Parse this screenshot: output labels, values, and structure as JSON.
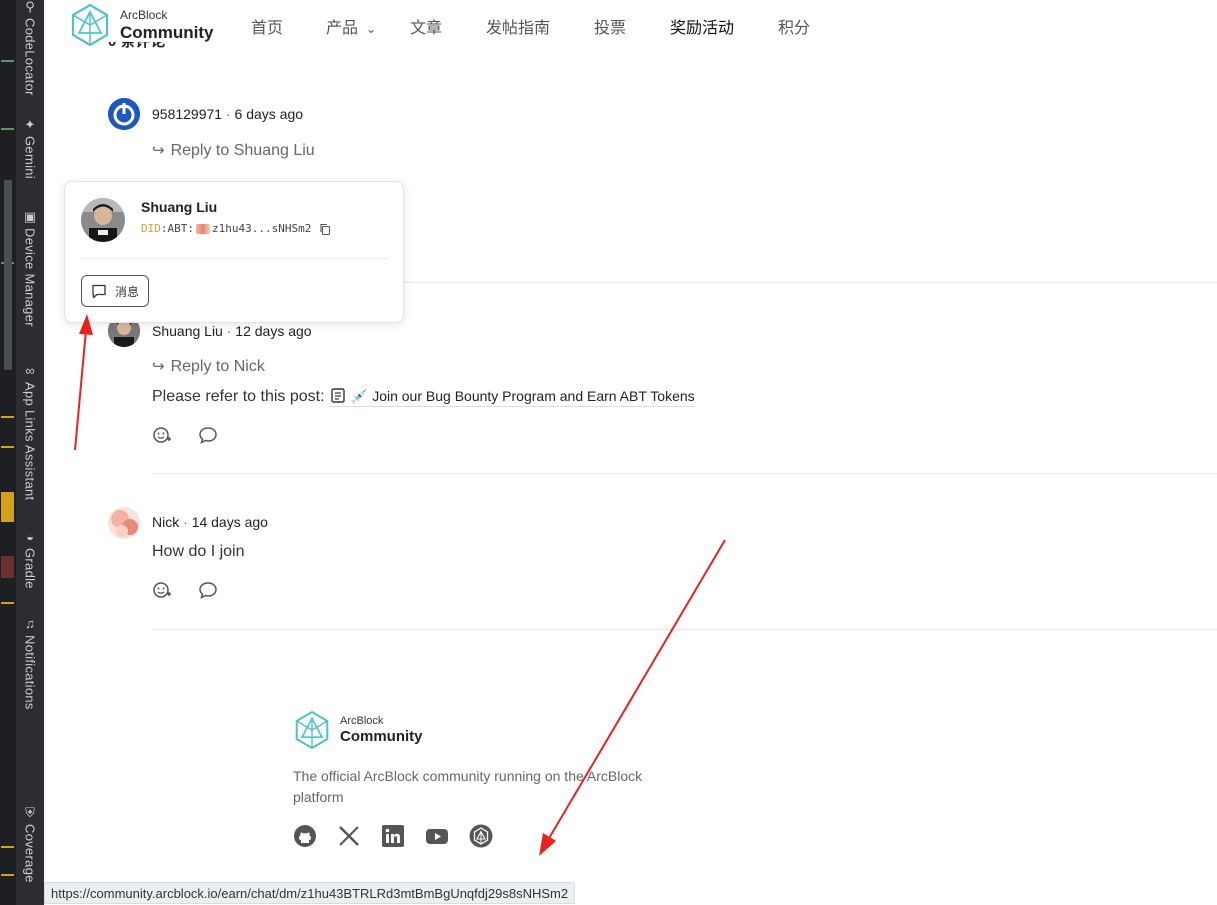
{
  "ide": {
    "tools": [
      {
        "icon": "code-locator-icon",
        "label": "CodeLocator"
      },
      {
        "icon": "gemini-icon",
        "label": "Gemini"
      },
      {
        "icon": "device-manager-icon",
        "label": "Device Manager"
      },
      {
        "icon": "app-links-icon",
        "label": "App Links Assistant"
      },
      {
        "icon": "gradle-icon",
        "label": "Gradle"
      },
      {
        "icon": "notifications-icon",
        "label": "Notifications"
      },
      {
        "icon": "coverage-icon",
        "label": "Coverage"
      }
    ]
  },
  "brand": {
    "small": "ArcBlock",
    "big": "Community",
    "accent": "#4fc3c7"
  },
  "nav": {
    "items": [
      "首页",
      "产品",
      "文章",
      "发帖指南",
      "投票",
      "奖励活动",
      "积分"
    ],
    "active": "奖励活动"
  },
  "section_heading_partial": "0 条评论",
  "comments": [
    {
      "user": "958129971",
      "time": "6 days ago",
      "reply_to": "Reply to Shuang Liu"
    },
    {
      "user": "Shuang Liu",
      "time": "12 days ago",
      "reply_to": "Reply to Nick",
      "body_prefix": "Please refer to this post:",
      "post_emoji": "💉",
      "post_title": "Join our Bug Bounty Program and Earn ABT Tokens"
    },
    {
      "user": "Nick",
      "time": "14 days ago",
      "body": "How do I join"
    }
  ],
  "meta_separator": "·",
  "popover": {
    "name": "Shuang Liu",
    "did_prefix": "DID",
    "did_type": ":ABT:",
    "did_short": "z1hu43...sNHSm2",
    "message_button": "消息"
  },
  "footer": {
    "description": "The official ArcBlock community running on the ArcBlock platform",
    "social": [
      "github-icon",
      "x-icon",
      "linkedin-icon",
      "youtube-icon",
      "arcblock-icon"
    ]
  },
  "status_url": "https://community.arcblock.io/earn/chat/dm/z1hu43BTRLRd3mtBmBgUnqfdj29s8sNHSm2",
  "colors": {
    "annotation": "#e8231d",
    "did_prefix": "#e39a3b",
    "text_muted": "#666666"
  }
}
